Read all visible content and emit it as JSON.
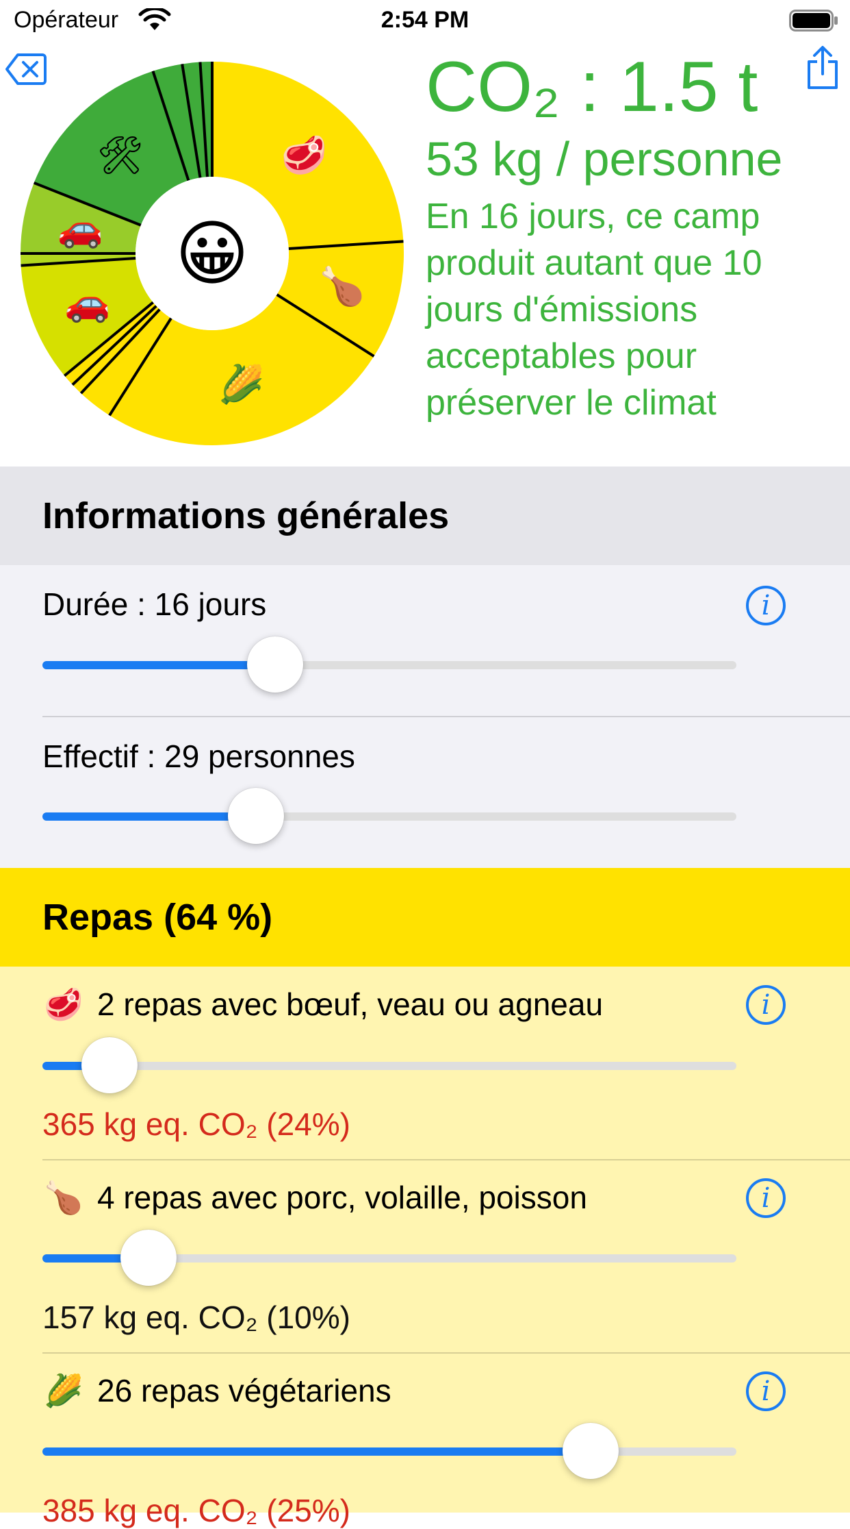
{
  "status_bar": {
    "carrier": "Opérateur",
    "time": "2:54 PM",
    "battery_level": 1.0
  },
  "toolbar": {
    "clear_icon": "clear-icon",
    "share_icon": "share-icon"
  },
  "summary": {
    "co2_title": "CO₂ : 1.5 t",
    "per_person": "53 kg / personne",
    "comparison": "En 16 jours, ce camp produit autant que 10 jours d'émissions acceptables pour préserver le climat",
    "center_emoji": "😀",
    "color": "#3db43d"
  },
  "pie": {
    "segments": [
      {
        "name": "boeuf",
        "percent": 24,
        "color": "#ffe200",
        "emoji": "🥩"
      },
      {
        "name": "porc-volaille-poisson",
        "percent": 10,
        "color": "#ffe200",
        "emoji": "🍗"
      },
      {
        "name": "vegetarien",
        "percent": 25,
        "color": "#ffe200",
        "emoji": "🌽"
      },
      {
        "name": "repas-4",
        "percent": 3,
        "color": "#ffe200",
        "emoji": ""
      },
      {
        "name": "repas-5",
        "percent": 1,
        "color": "#ffe200",
        "emoji": ""
      },
      {
        "name": "repas-6",
        "percent": 1,
        "color": "#ffe200",
        "emoji": ""
      },
      {
        "name": "voiture-1",
        "percent": 10,
        "color": "#d6e000",
        "emoji": "🚗"
      },
      {
        "name": "voiture-2",
        "percent": 1,
        "color": "#b2d81e",
        "emoji": ""
      },
      {
        "name": "voiture-3",
        "percent": 6,
        "color": "#98cc2a",
        "emoji": "🚗"
      },
      {
        "name": "materiel",
        "percent": 14,
        "color": "#3fab3a",
        "emoji": "🛠"
      },
      {
        "name": "materiel-2",
        "percent": 2.5,
        "color": "#3fab3a",
        "emoji": ""
      },
      {
        "name": "materiel-3",
        "percent": 1.5,
        "color": "#3fab3a",
        "emoji": ""
      },
      {
        "name": "materiel-4",
        "percent": 1,
        "color": "#3fab3a",
        "emoji": ""
      }
    ]
  },
  "general": {
    "title": "Informations générales",
    "rows": [
      {
        "label": "Durée : 16 jours",
        "slider_value": 0.335,
        "has_info": true
      },
      {
        "label": "Effectif : 29 personnes",
        "slider_value": 0.308,
        "has_info": false
      }
    ]
  },
  "meals": {
    "title": "Repas (64 %)",
    "header_color": "#ffe200",
    "rows": [
      {
        "emoji": "🥩",
        "label": "2 repas avec bœuf, veau ou agneau",
        "slider_value": 0.097,
        "value": "365 kg eq. CO₂ (24%)",
        "value_color": "#d42a1c"
      },
      {
        "emoji": "🍗",
        "label": "4 repas avec porc, volaille, poisson",
        "slider_value": 0.153,
        "value": "157 kg eq. CO₂ (10%)",
        "value_color": "#111111"
      },
      {
        "emoji": "🌽",
        "label": "26 repas végétariens",
        "slider_value": 0.79,
        "value": "385 kg eq. CO₂ (25%)",
        "value_color": "#d42a1c"
      }
    ],
    "info_glyph": "i"
  }
}
